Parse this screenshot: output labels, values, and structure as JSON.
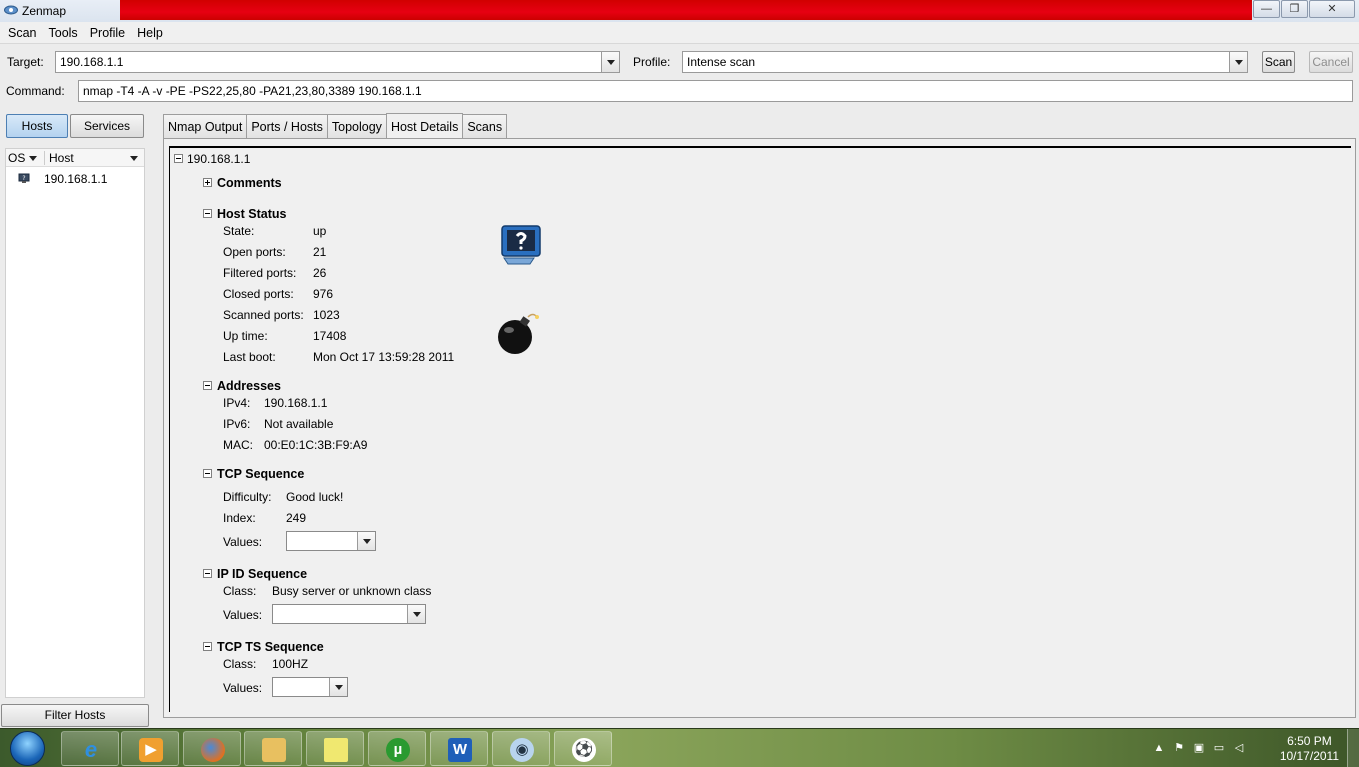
{
  "window": {
    "title": "Zenmap",
    "controls": {
      "minimize": "—",
      "maximize": "❐",
      "close": "✕"
    }
  },
  "menu": [
    "Scan",
    "Tools",
    "Profile",
    "Help"
  ],
  "toolbar": {
    "target_label": "Target:",
    "target_value": "190.168.1.1",
    "profile_label": "Profile:",
    "profile_value": "Intense scan",
    "scan_button": "Scan",
    "cancel_button": "Cancel",
    "command_label": "Command:",
    "command_value": "nmap -T4 -A -v -PE -PS22,25,80 -PA21,23,80,3389 190.168.1.1"
  },
  "left_panel": {
    "hosts_button": "Hosts",
    "services_button": "Services",
    "columns": [
      "OS",
      "Host"
    ],
    "hosts": [
      {
        "name": "190.168.1.1",
        "os_icon": "unknown-os-icon"
      }
    ],
    "filter_button": "Filter Hosts"
  },
  "tabs": [
    {
      "label": "Nmap Output",
      "active": false
    },
    {
      "label": "Ports / Hosts",
      "active": false
    },
    {
      "label": "Topology",
      "active": false
    },
    {
      "label": "Host Details",
      "active": true
    },
    {
      "label": "Scans",
      "active": false
    }
  ],
  "details": {
    "host": "190.168.1.1",
    "comments": {
      "title": "Comments",
      "expanded": false
    },
    "host_status": {
      "title": "Host Status",
      "rows": [
        {
          "label": "State:",
          "value": "up"
        },
        {
          "label": "Open ports:",
          "value": "21"
        },
        {
          "label": "Filtered ports:",
          "value": "26"
        },
        {
          "label": "Closed ports:",
          "value": "976"
        },
        {
          "label": "Scanned ports:",
          "value": "1023"
        },
        {
          "label": "Up time:",
          "value": "17408"
        },
        {
          "label": "Last boot:",
          "value": "Mon Oct 17 13:59:28 2011"
        }
      ],
      "os_icon": "unknown-os-monitor-icon",
      "vulnerability_icon": "bomb-icon"
    },
    "addresses": {
      "title": "Addresses",
      "rows": [
        {
          "label": "IPv4:",
          "value": "190.168.1.1"
        },
        {
          "label": "IPv6:",
          "value": "Not available"
        },
        {
          "label": "MAC:",
          "value": "00:E0:1C:3B:F9:A9"
        }
      ]
    },
    "tcp_sequence": {
      "title": "TCP Sequence",
      "rows": [
        {
          "label": "Difficulty:",
          "value": "Good luck!"
        },
        {
          "label": "Index:",
          "value": "249"
        },
        {
          "label": "Values:",
          "value": ""
        }
      ]
    },
    "ip_id_sequence": {
      "title": "IP ID Sequence",
      "rows": [
        {
          "label": "Class:",
          "value": "Busy server or unknown class"
        },
        {
          "label": "Values:",
          "value": ""
        }
      ]
    },
    "tcp_ts_sequence": {
      "title": "TCP TS Sequence",
      "rows": [
        {
          "label": "Class:",
          "value": "100HZ"
        },
        {
          "label": "Values:",
          "value": ""
        }
      ]
    }
  },
  "taskbar": {
    "apps": [
      "internet-explorer-icon",
      "media-player-icon",
      "firefox-icon",
      "file-explorer-icon",
      "sticky-notes-icon",
      "utorrent-icon",
      "word-icon",
      "zenmap-eye-icon",
      "soccer-ball-icon"
    ],
    "clock_time": "6:50 PM",
    "clock_date": "10/17/2011"
  }
}
